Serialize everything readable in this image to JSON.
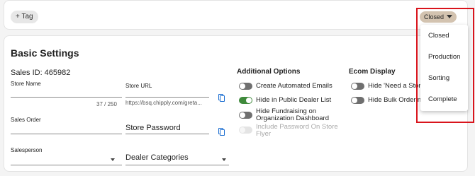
{
  "tag_bar": {
    "add_tag_label": "+ Tag",
    "status_value": "Closed"
  },
  "basic_settings": {
    "title": "Basic Settings",
    "sales_id": "Sales ID: 465982",
    "store_name": {
      "label": "Store Name",
      "value": "",
      "counter": "37 / 250"
    },
    "store_url": {
      "label": "Store URL",
      "value": "https://bsq.chipply.com/greta..."
    },
    "sales_order": {
      "label": "Sales Order",
      "value": ""
    },
    "store_password": {
      "placeholder": "Store Password"
    },
    "salesperson": {
      "label": "Salesperson",
      "value": ""
    },
    "dealer_categories": {
      "placeholder": "Dealer Categories"
    }
  },
  "additional_options": {
    "title": "Additional Options",
    "toggles": [
      {
        "label": "Create Automated Emails",
        "state": "off"
      },
      {
        "label": "Hide in Public Dealer List",
        "state": "on"
      },
      {
        "label": "Hide Fundraising on Organization Dashboard",
        "state": "off"
      },
      {
        "label": "Include Password On Store Flyer",
        "state": "disabled"
      }
    ]
  },
  "ecom_display": {
    "title": "Ecom Display",
    "toggles": [
      {
        "label": "Hide 'Need a Store",
        "state": "off"
      },
      {
        "label": "Hide Bulk Ordering",
        "state": "off"
      }
    ]
  },
  "status_menu": {
    "options": [
      "Closed",
      "Production",
      "Sorting",
      "Complete"
    ]
  },
  "colors": {
    "accent_blue": "#1d6fd1",
    "toggle_on": "#3f8a3c",
    "highlight_red": "#d9141c",
    "status_pill": "#d3c3b0"
  }
}
